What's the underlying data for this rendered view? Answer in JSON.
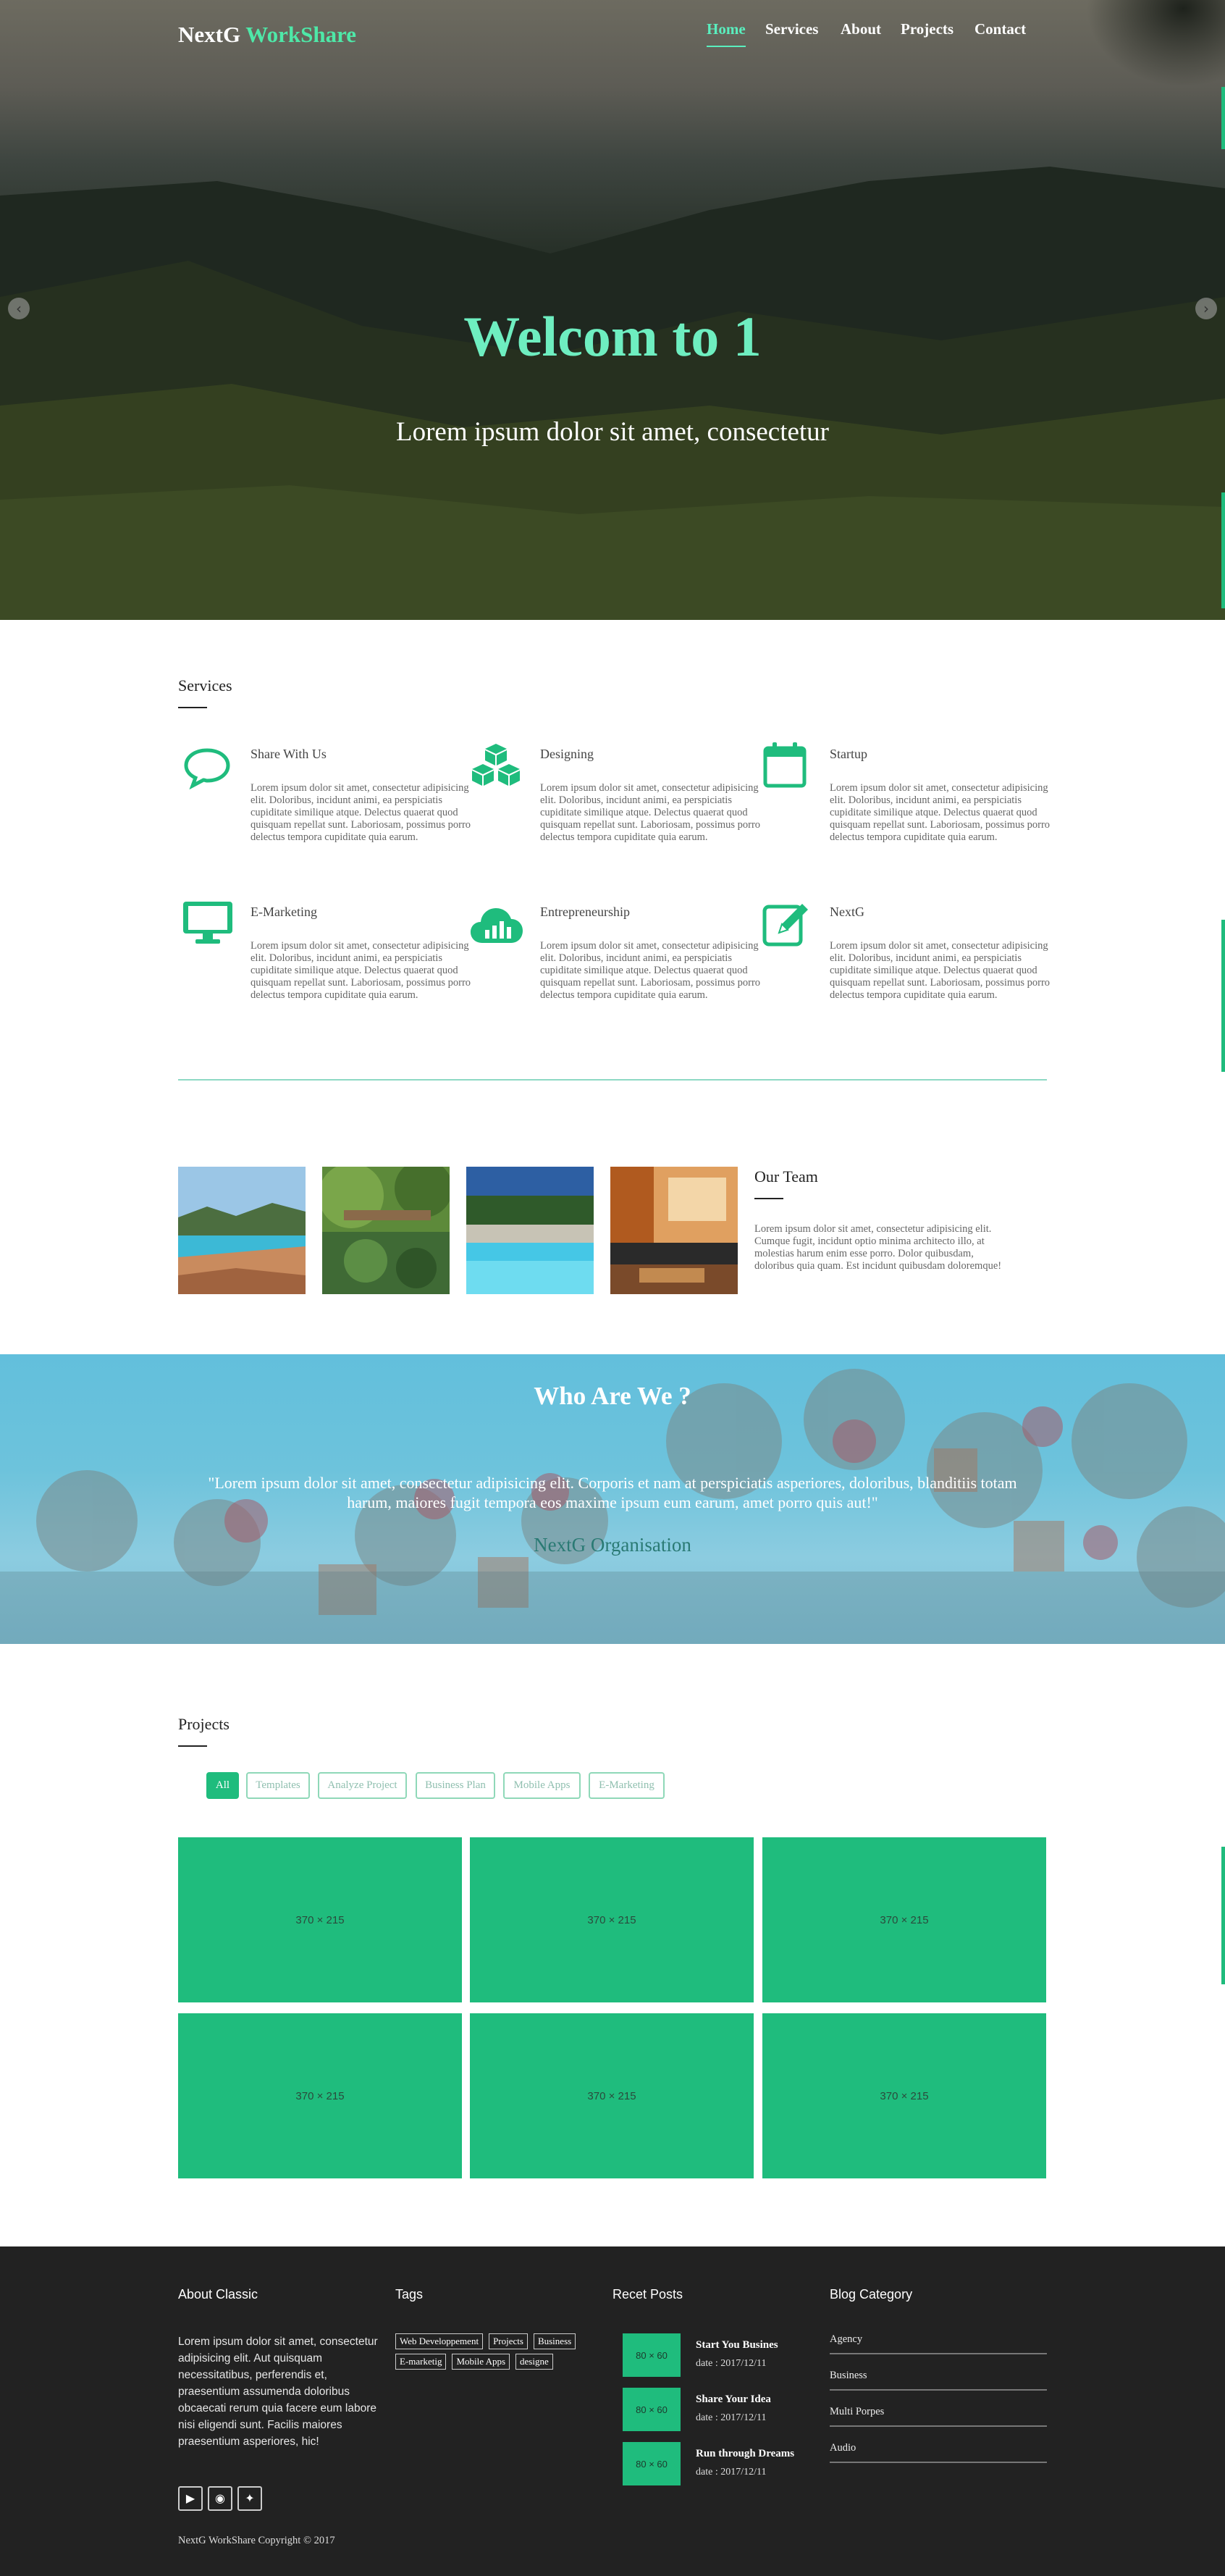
{
  "colors": {
    "accent": "#1fbc7d",
    "hero_title": "#6eeec0",
    "footer_bg": "#222222",
    "who_bg": "#62bfdc"
  },
  "brand": {
    "name": "NextG",
    "accent": "WorkShare"
  },
  "nav": {
    "items": [
      "Home",
      "Services",
      "About",
      "Projects",
      "Contact"
    ],
    "active": "Home"
  },
  "hero": {
    "title": "Welcom to 1",
    "subtitle": "Lorem ipsum dolor sit amet, consectetur",
    "prev_icon": "chevron-left-icon",
    "next_icon": "chevron-right-icon"
  },
  "services": {
    "title": "Services",
    "text": "Lorem ipsum dolor sit amet, consectetur adipisicing elit. Doloribus, incidunt animi, ea perspiciatis cupiditate similique atque. Delectus quaerat quod quisquam repellat sunt. Laboriosam, possimus porro delectus tempora cupiditate quia earum.",
    "items": [
      {
        "title": "Share With Us",
        "icon": "chat-bubble-icon"
      },
      {
        "title": "Designing",
        "icon": "cubes-icon"
      },
      {
        "title": "Startup",
        "icon": "calendar-icon"
      },
      {
        "title": "E-Marketing",
        "icon": "desktop-icon"
      },
      {
        "title": "Entrepreneurship",
        "icon": "cloud-chart-icon"
      },
      {
        "title": "NextG",
        "icon": "edit-icon"
      }
    ]
  },
  "team": {
    "title": "Our Team",
    "text": "Lorem ipsum dolor sit amet, consectetur adipisicing elit. Cumque fugit, incidunt optio minima architecto illo, at molestias harum enim esse porro. Dolor quibusdam, doloribus quia quam. Est incidunt quibusdam doloremque!"
  },
  "who": {
    "title": "Who Are We ?",
    "quote": "\"Lorem ipsum dolor sit amet, consectetur adipisicing elit. Corporis et nam at perspiciatis asperiores, doloribus, blanditiis totam harum, maiores fugit tempora eos maxime ipsum eum earum, amet porro quis aut!\"",
    "author": "NextG Organisation"
  },
  "projects": {
    "title": "Projects",
    "filters": [
      "All",
      "Templates",
      "Analyze Project",
      "Business Plan",
      "Mobile Apps",
      "E-Marketing"
    ],
    "active_filter": "All",
    "placeholder": "370 × 215"
  },
  "footer": {
    "about": {
      "title": "About Classic",
      "text": "Lorem ipsum dolor sit amet, consectetur adipisicing elit. Aut quisquam necessitatibus, perferendis et, praesentium assumenda doloribus obcaecati rerum quia facere eum labore nisi eligendi sunt. Facilis maiores praesentium asperiores, hic!"
    },
    "tags": {
      "title": "Tags",
      "items": [
        "Web Developpement",
        "Projects",
        "Business",
        "E-marketig",
        "Mobile Apps",
        "designe"
      ]
    },
    "posts": {
      "title": "Recet Posts",
      "thumb": "80 × 60",
      "items": [
        {
          "title": "Start You Busines",
          "date": "date : 2017/12/11"
        },
        {
          "title": "Share Your Idea",
          "date": "date : 2017/12/11"
        },
        {
          "title": "Run through Dreams",
          "date": "date : 2017/12/11"
        }
      ]
    },
    "category": {
      "title": "Blog Category",
      "items": [
        "Agency",
        "Business",
        "Multi Porpes",
        "Audio"
      ]
    },
    "social": [
      "youtube-icon",
      "github-icon",
      "twitter-icon"
    ],
    "copyright": "NextG WorkShare Copyright © 2017"
  }
}
